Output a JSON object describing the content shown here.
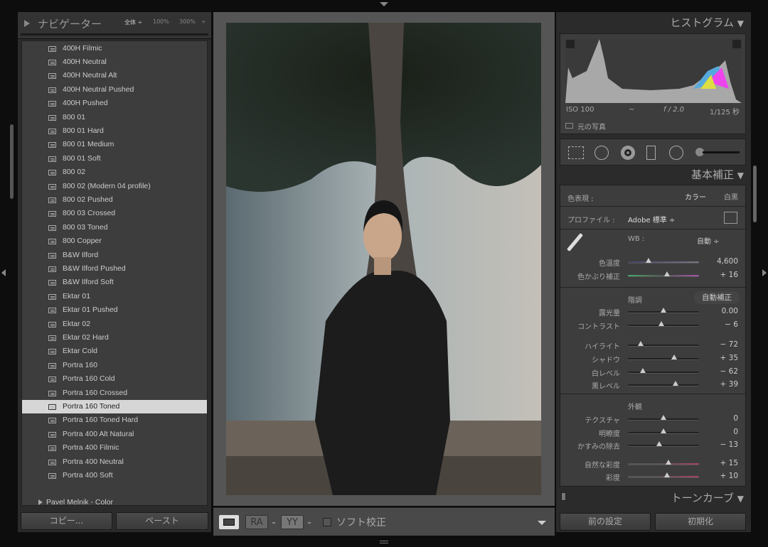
{
  "navigator": {
    "title": "ナビゲーター",
    "zoom_fit": "全体 ÷",
    "zoom_100": "100%",
    "zoom_300": "300%",
    "zoom_arrow": "÷"
  },
  "presets": {
    "items": [
      "400H Filmic",
      "400H Neutral",
      "400H Neutral Alt",
      "400H Neutral Pushed",
      "400H Pushed",
      "800 01",
      "800 01 Hard",
      "800 01 Medium",
      "800 01 Soft",
      "800 02",
      "800 02 (Modern 04 profile)",
      "800 02 Pushed",
      "800 03 Crossed",
      "800 03 Toned",
      "800 Copper",
      "B&W Ilford",
      "B&W Ilford Pushed",
      "B&W Ilford Soft",
      "Ektar 01",
      "Ektar 01 Pushed",
      "Ektar 02",
      "Ektar 02 Hard",
      "Ektar Cold",
      "Portra 160",
      "Portra 160 Cold",
      "Portra 160 Crossed",
      "Portra 160 Toned",
      "Portra 160 Toned Hard",
      "Portra 400 Alt Natural",
      "Portra 400 Filmic",
      "Portra 400 Neutral",
      "Portra 400 Soft"
    ],
    "selected_index": 26,
    "folder": "Pavel Melnik - Color"
  },
  "left_buttons": {
    "copy": "コピー...",
    "paste": "ペースト"
  },
  "toolbar": {
    "view_ra": "RA",
    "view_yy": "YY",
    "soft_proof": "ソフト校正",
    "soft_proof_checked": false
  },
  "histogram": {
    "title": "ヒストグラム",
    "iso": "ISO 100",
    "focal": "~",
    "aperture": "f / 2.0",
    "shutter": "1/125 秒",
    "original": "元の写真"
  },
  "basic": {
    "title": "基本補正",
    "treatment_label": "色表現 :",
    "color": "カラー",
    "bw": "白黒",
    "profile_label": "プロファイル :",
    "profile": "Adobe 標準 ÷",
    "wb_label": "WB :",
    "wb": "自動 ÷",
    "tone_label": "階調",
    "auto": "自動補正",
    "presence_label": "外観",
    "sliders": [
      {
        "label": "色温度",
        "value": "4,600",
        "level": 0.29,
        "track": "temp"
      },
      {
        "label": "色かぶり補正",
        "value": "+ 16",
        "level": 0.55,
        "track": "tint"
      },
      {
        "label": "露光量",
        "value": "0.00",
        "level": 0.5
      },
      {
        "label": "コントラスト",
        "value": "− 6",
        "level": 0.47
      },
      {
        "label": "ハイライト",
        "value": "− 72",
        "level": 0.18
      },
      {
        "label": "シャドウ",
        "value": "+ 35",
        "level": 0.65
      },
      {
        "label": "白レベル",
        "value": "− 62",
        "level": 0.21
      },
      {
        "label": "黒レベル",
        "value": "+ 39",
        "level": 0.67
      },
      {
        "label": "テクスチャ",
        "value": "0",
        "level": 0.5
      },
      {
        "label": "明瞭度",
        "value": "0",
        "level": 0.5
      },
      {
        "label": "かすみの除去",
        "value": "− 13",
        "level": 0.44
      },
      {
        "label": "自然な彩度",
        "value": "+ 15",
        "level": 0.57,
        "track": "sat"
      },
      {
        "label": "彩度",
        "value": "+ 10",
        "level": 0.55,
        "track": "sat"
      }
    ]
  },
  "tone_curve": {
    "title": "トーンカーブ"
  },
  "right_buttons": {
    "previous": "前の設定",
    "reset": "初期化"
  }
}
